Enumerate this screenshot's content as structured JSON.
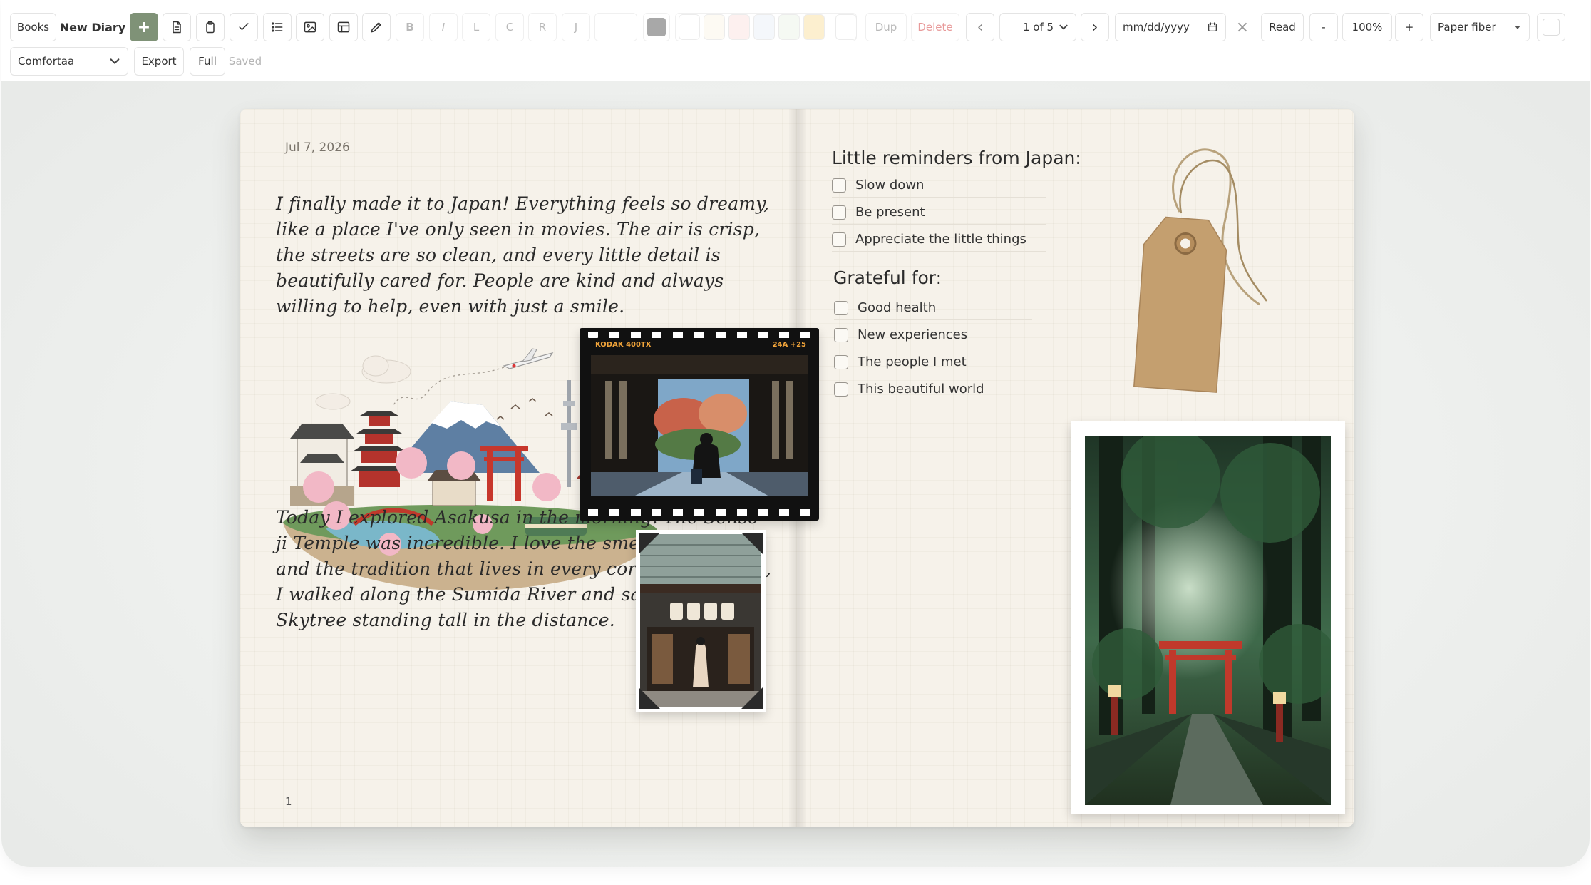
{
  "toolbar": {
    "books_label": "Books",
    "diary_name": "New Diary",
    "add_label": "+",
    "format_bold": "B",
    "format_italic": "I",
    "align_left": "L",
    "align_center": "C",
    "align_right": "R",
    "align_justify": "J",
    "duplicate_label": "Dup",
    "delete_label": "Delete",
    "prev_label": "‹",
    "next_label": "›",
    "page_indicator": "1 of 5",
    "date_placeholder": "mm/dd/yyyy",
    "clear_label": "×",
    "read_label": "Read",
    "zoom_out_label": "-",
    "zoom_level": "100%",
    "zoom_in_label": "+",
    "paper_style": "Paper fiber",
    "font_family_value": "Comfortaa",
    "export_label": "Export",
    "full_label": "Full",
    "save_status": "Saved",
    "accent_color": "#7f9277",
    "text_color_swatch": "#a8a8a8",
    "swatches": [
      "#ffffff",
      "#fdfaf3",
      "#fdf0ef",
      "#f4f7fb",
      "#f5f9f3",
      "#fcefcf",
      "#ffffff"
    ]
  },
  "left_page": {
    "date": "Jul 7, 2026",
    "paragraph_1": "I finally made it to Japan! Everything feels so dreamy, like a place I've only seen in movies. The air is crisp, the streets are so clean, and every little detail is beautifully cared for. People are kind and always willing to help, even with just a smile.",
    "paragraph_2": "Today I explored Asakusa in the morning. The Senso-ji Temple was incredible. I love the smell of incense and the tradition that lives in every corner. After that, I walked along the Sumida River and saw Tokyo Skytree standing tall in the distance.",
    "page_number": "1"
  },
  "right_page": {
    "reminders_title": "Little reminders from Japan:",
    "reminders": [
      "Slow down",
      "Be present",
      "Appreciate the little things"
    ],
    "grateful_title": "Grateful for:",
    "grateful": [
      "Good health",
      "New experiences",
      "The people I met",
      "This beautiful world"
    ],
    "film_brand": "KODAK 400TX",
    "film_frame": "24A +25"
  }
}
